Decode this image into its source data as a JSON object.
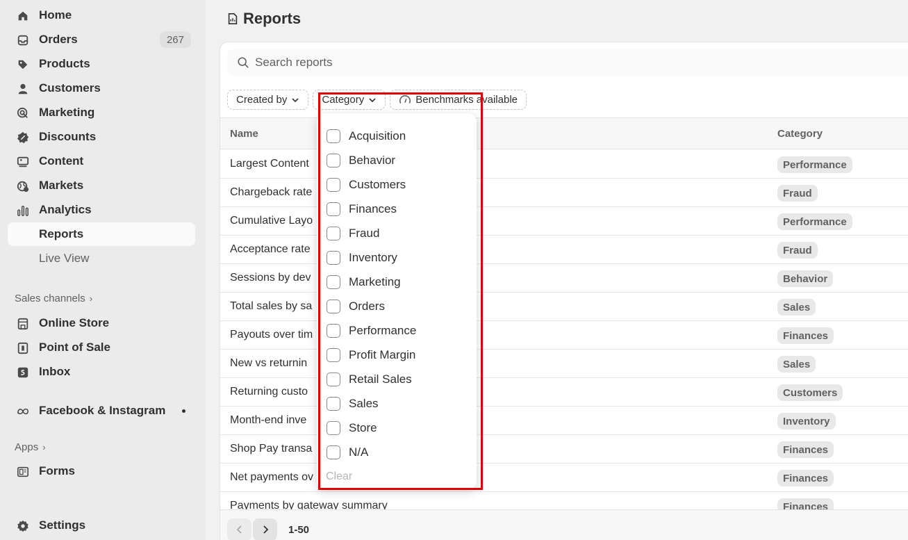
{
  "sidebar": {
    "items": [
      {
        "label": "Home",
        "icon": "home-icon"
      },
      {
        "label": "Orders",
        "icon": "orders-icon",
        "badge": "267"
      },
      {
        "label": "Products",
        "icon": "tag-icon"
      },
      {
        "label": "Customers",
        "icon": "person-icon"
      },
      {
        "label": "Marketing",
        "icon": "target-icon"
      },
      {
        "label": "Discounts",
        "icon": "discount-icon"
      },
      {
        "label": "Content",
        "icon": "content-icon"
      },
      {
        "label": "Markets",
        "icon": "globe-icon"
      },
      {
        "label": "Analytics",
        "icon": "chart-icon"
      },
      {
        "label": "Reports"
      },
      {
        "label": "Live View"
      }
    ],
    "sales_channels": {
      "title": "Sales channels",
      "items": [
        {
          "label": "Online Store",
          "icon": "store-icon"
        },
        {
          "label": "Point of Sale",
          "icon": "pos-icon"
        },
        {
          "label": "Inbox",
          "icon": "inbox-icon"
        }
      ]
    },
    "meta": {
      "label": "Facebook & Instagram",
      "icon": "meta-icon"
    },
    "apps": {
      "title": "Apps",
      "items": [
        {
          "label": "Forms",
          "icon": "forms-icon"
        }
      ]
    },
    "settings": {
      "label": "Settings",
      "icon": "gear-icon"
    }
  },
  "page": {
    "title": "Reports",
    "search_placeholder": "Search reports",
    "filters": {
      "created_by": "Created by",
      "category": "Category",
      "benchmarks": "Benchmarks available"
    },
    "columns": {
      "name": "Name",
      "category": "Category"
    },
    "rows": [
      {
        "name": "Largest Content",
        "category": "Performance"
      },
      {
        "name": "Chargeback rate",
        "category": "Fraud"
      },
      {
        "name": "Cumulative Layo",
        "category": "Performance"
      },
      {
        "name": "Acceptance rate",
        "category": "Fraud"
      },
      {
        "name": "Sessions by dev",
        "category": "Behavior"
      },
      {
        "name": "Total sales by sa",
        "category": "Sales"
      },
      {
        "name": "Payouts over tim",
        "category": "Finances"
      },
      {
        "name": "New vs returnin",
        "category": "Sales"
      },
      {
        "name": "Returning custo",
        "category": "Customers"
      },
      {
        "name": "Month-end inve",
        "category": "Inventory"
      },
      {
        "name": "Shop Pay transa",
        "category": "Finances"
      },
      {
        "name": "Net payments ov",
        "category": "Finances"
      },
      {
        "name": "Payments by gateway summary",
        "category": "Finances"
      }
    ],
    "pagination": {
      "range": "1-50"
    }
  },
  "dropdown": {
    "options": [
      "Acquisition",
      "Behavior",
      "Customers",
      "Finances",
      "Fraud",
      "Inventory",
      "Marketing",
      "Orders",
      "Performance",
      "Profit Margin",
      "Retail Sales",
      "Sales",
      "Store",
      "N/A"
    ],
    "clear": "Clear"
  },
  "colors": {
    "highlight": "#e00000",
    "active_bg": "#fafafa"
  }
}
